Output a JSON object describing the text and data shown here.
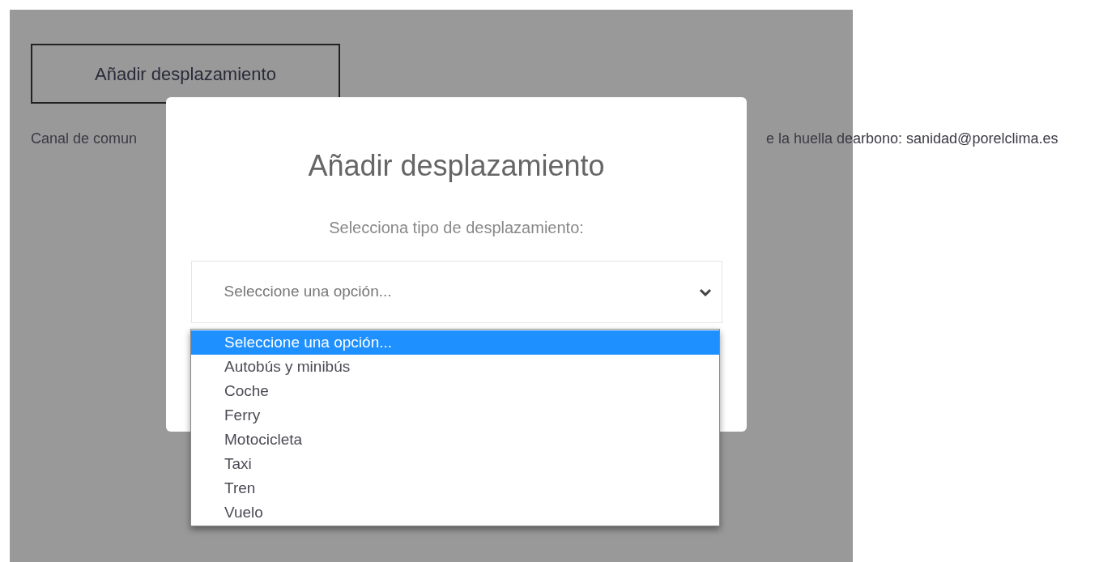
{
  "page": {
    "button": "Añadir desplazamiento",
    "text_left": "Canal de comun",
    "text_middle": "e la huella de",
    "text_right": "arbono: sanidad@porelclima.es"
  },
  "modal": {
    "title": "Añadir desplazamiento",
    "label": "Selecciona tipo de desplazamiento:",
    "select": {
      "value": "Seleccione una opción...",
      "expanded": true,
      "options": [
        {
          "label": "Seleccione una opción...",
          "selected": true
        },
        {
          "label": "Autobús y minibús",
          "selected": false
        },
        {
          "label": "Coche",
          "selected": false
        },
        {
          "label": "Ferry",
          "selected": false
        },
        {
          "label": "Motocicleta",
          "selected": false
        },
        {
          "label": "Taxi",
          "selected": false
        },
        {
          "label": "Tren",
          "selected": false
        },
        {
          "label": "Vuelo",
          "selected": false
        }
      ]
    }
  }
}
